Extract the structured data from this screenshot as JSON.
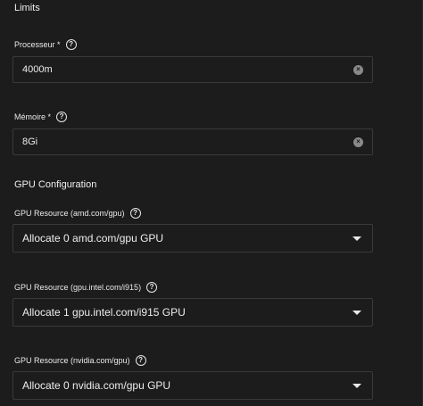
{
  "limits": {
    "title": "Limits",
    "processor": {
      "label": "Processeur *",
      "value": "4000m"
    },
    "memory": {
      "label": "Mémoire *",
      "value": "8Gi"
    }
  },
  "gpu": {
    "title": "GPU Configuration",
    "resources": [
      {
        "label": "GPU Resource (amd.com/gpu)",
        "value": "Allocate 0 amd.com/gpu GPU"
      },
      {
        "label": "GPU Resource (gpu.intel.com/i915)",
        "value": "Allocate 1 gpu.intel.com/i915 GPU"
      },
      {
        "label": "GPU Resource (nvidia.com/gpu)",
        "value": "Allocate 0 nvidia.com/gpu GPU"
      }
    ]
  },
  "icons": {
    "help": "help-circle-icon",
    "clear": "clear-icon",
    "dropdown": "chevron-down-icon"
  }
}
